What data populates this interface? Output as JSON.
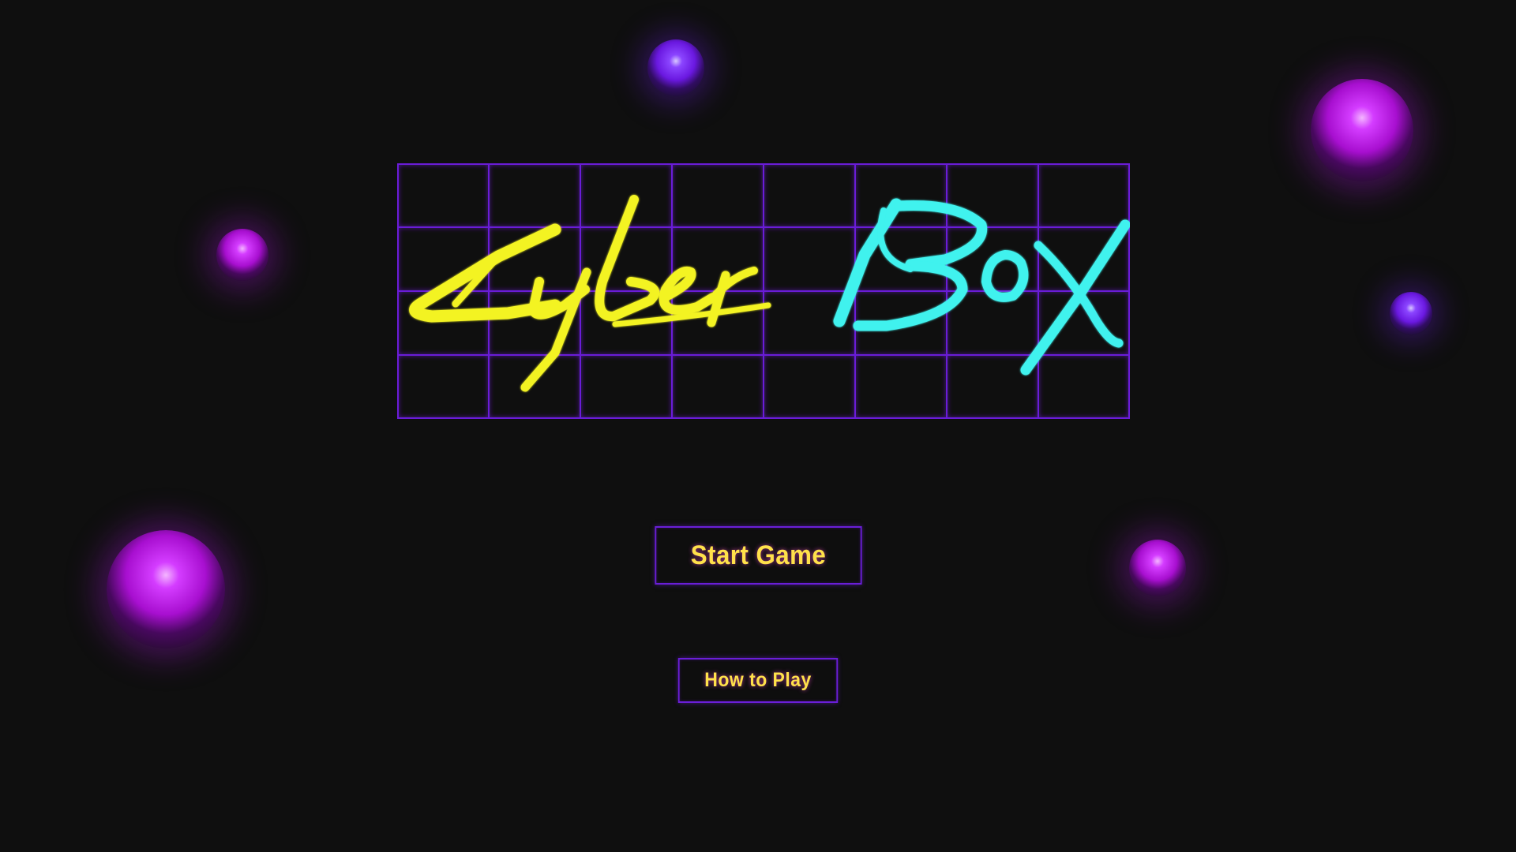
{
  "logo": {
    "text_part1": "Cyber",
    "text_part2": "Box",
    "color_part1": "#f3f324",
    "color_part2": "#3ff2ee",
    "grid_color": "#6a1ed8"
  },
  "menu": {
    "start_label": "Start Game",
    "howto_label": "How to Play"
  },
  "colors": {
    "background": "#0f0f0f",
    "button_text": "#ffe14a",
    "button_border": "#6a1ed8",
    "orb_magenta": "#b416e0",
    "orb_violet": "#6a18e0"
  }
}
